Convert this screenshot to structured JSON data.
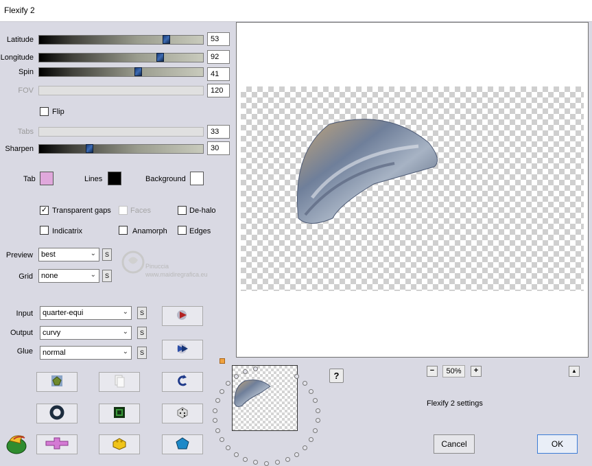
{
  "window": {
    "title": "Flexify 2"
  },
  "sliders": [
    {
      "label": "Latitude",
      "value": "53",
      "level": 0.79,
      "disabled": false
    },
    {
      "label": "Longitude",
      "value": "92",
      "level": 0.75,
      "disabled": false
    },
    {
      "label": "Spin",
      "value": "41",
      "level": 0.61,
      "disabled": false
    },
    {
      "label": "FOV",
      "value": "120",
      "level": null,
      "disabled": true
    }
  ],
  "flip": {
    "label": "Flip",
    "checked": false
  },
  "sliders2": [
    {
      "label": "Tabs",
      "value": "33",
      "level": null,
      "disabled": true
    },
    {
      "label": "Sharpen",
      "value": "30",
      "level": 0.3,
      "disabled": false
    }
  ],
  "colors": {
    "tab": {
      "label": "Tab",
      "color": "#e0a8dc"
    },
    "lines": {
      "label": "Lines",
      "color": "#000000"
    },
    "background": {
      "label": "Background",
      "color": "#ffffff"
    }
  },
  "options": {
    "transparent_gaps": {
      "label": "Transparent gaps",
      "checked": true,
      "disabled": false
    },
    "faces": {
      "label": "Faces",
      "checked": false,
      "disabled": true
    },
    "de_halo": {
      "label": "De-halo",
      "checked": false,
      "disabled": false
    },
    "indicatrix": {
      "label": "Indicatrix",
      "checked": false,
      "disabled": false
    },
    "anamorph": {
      "label": "Anamorph",
      "checked": false,
      "disabled": false
    },
    "edges": {
      "label": "Edges",
      "checked": false,
      "disabled": false
    }
  },
  "preview_select": {
    "label": "Preview",
    "value": "best"
  },
  "grid_select": {
    "label": "Grid",
    "value": "none"
  },
  "s_label": "S",
  "input_select": {
    "label": "Input",
    "value": "quarter-equi"
  },
  "output_select": {
    "label": "Output",
    "value": "curvy"
  },
  "glue_select": {
    "label": "Glue",
    "value": "normal"
  },
  "watermark": {
    "line1": "Pinuccia",
    "line2": "www.maidiregrafica.eu"
  },
  "zoom": {
    "minus": "−",
    "value": "50%",
    "plus": "+"
  },
  "help_label": "?",
  "collapse_label": "▲",
  "settings_label": "Flexify 2 settings",
  "cancel_label": "Cancel",
  "ok_label": "OK",
  "icons": {
    "render": "play-arrow-icon",
    "animate": "animate-icon",
    "randomize": "randomize-icon",
    "copy": "copy-icon",
    "undo": "undo-icon",
    "torus": "torus-icon",
    "frame": "frame-icon",
    "dice": "dice-icon",
    "flexify_logo": "flexify-logo-icon",
    "cross": "cross-icon",
    "cube": "cube-icon",
    "pentagon": "pentagon-icon"
  }
}
